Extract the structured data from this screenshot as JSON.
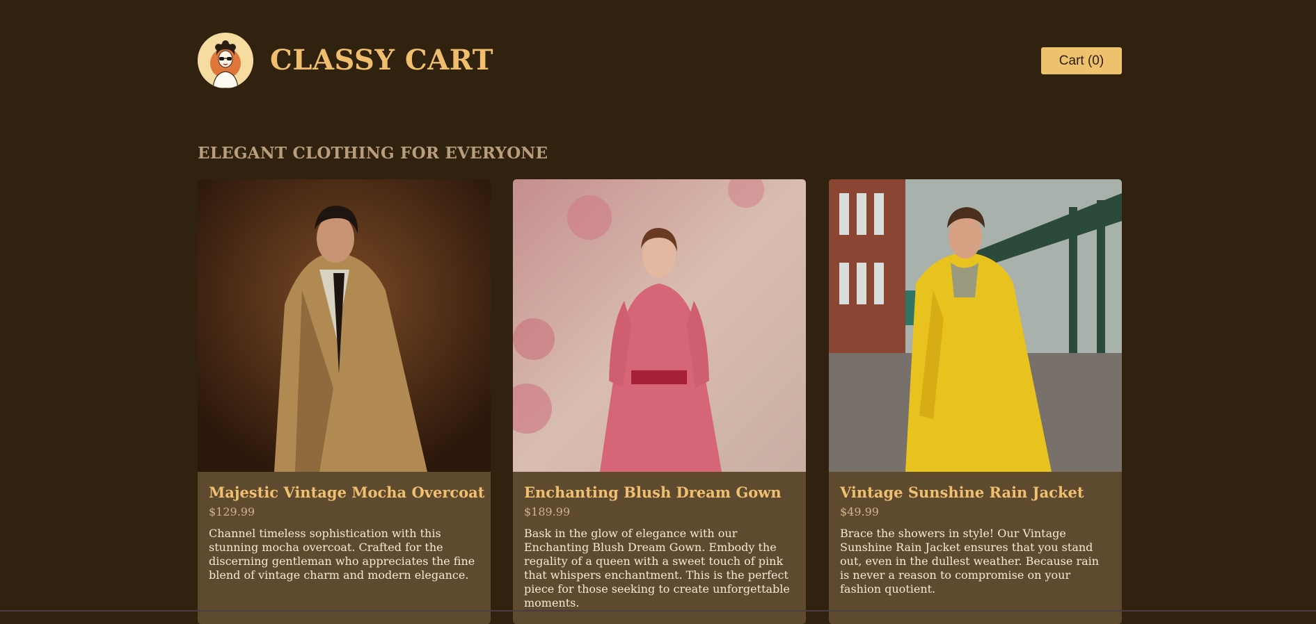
{
  "brand": {
    "name": "CLASSY CART"
  },
  "header": {
    "cart_label": "Cart (0)"
  },
  "main": {
    "section_title": "ELEGANT CLOTHING FOR EVERYONE"
  },
  "products": [
    {
      "name": "Majestic Vintage Mocha Overcoat",
      "price": "$129.99",
      "description": "Channel timeless sophistication with this stunning mocha overcoat. Crafted for the discerning gentleman who appreciates the fine blend of vintage charm and modern elegance."
    },
    {
      "name": "Enchanting Blush Dream Gown",
      "price": "$189.99",
      "description": "Bask in the glow of elegance with our Enchanting Blush Dream Gown. Embody the regality of a queen with a sweet touch of pink that whispers enchantment. This is the perfect piece for those seeking to create unforgettable moments."
    },
    {
      "name": "Vintage Sunshine Rain Jacket",
      "price": "$49.99",
      "description": "Brace the showers in style! Our Vintage Sunshine Rain Jacket ensures that you stand out, even in the dullest weather. Because rain is never a reason to compromise on your fashion quotient."
    }
  ],
  "colors": {
    "background": "#30220f",
    "accent": "#eec16d",
    "card": "#5e4a2e"
  }
}
